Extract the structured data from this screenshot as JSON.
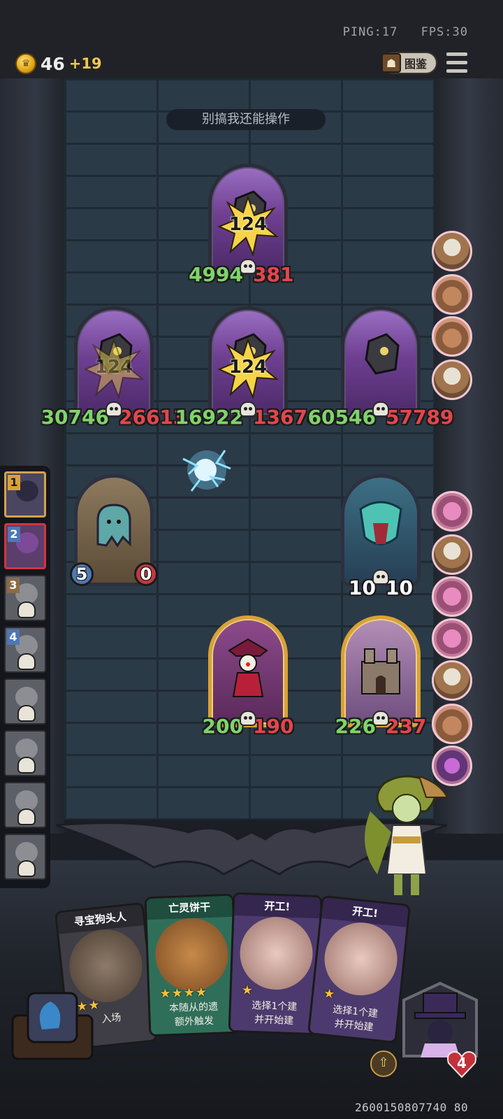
{
  "status": {
    "ping": "PING:17",
    "fps": "FPS:30"
  },
  "currency": {
    "gold": "46",
    "gold_income": "+19"
  },
  "codex": {
    "label": "图鉴"
  },
  "banner": "别搞我还能操作",
  "enemy_board": [
    {
      "name": "enemy-top",
      "damage": "124",
      "attack": "4994",
      "health": "381"
    },
    {
      "name": "enemy-mid-left",
      "damage": "124",
      "attack": "30746",
      "health": "26613"
    },
    {
      "name": "enemy-mid-center",
      "damage": "124",
      "attack": "16922",
      "health": "13674"
    },
    {
      "name": "enemy-mid-right",
      "attack": "60546",
      "health": "57789"
    }
  ],
  "lower_board": [
    {
      "name": "ghost",
      "attack": "5",
      "health": "0"
    },
    {
      "name": "spirit-titan",
      "attack": "10",
      "health": "10"
    }
  ],
  "player_board": [
    {
      "name": "clown",
      "attack": "200",
      "health": "190"
    },
    {
      "name": "castle",
      "attack": "226",
      "health": "237"
    }
  ],
  "roster": [
    {
      "rank": "1",
      "style": "gold"
    },
    {
      "rank": "2",
      "style": "blue"
    },
    {
      "rank": "3",
      "style": "brown"
    },
    {
      "rank": "4",
      "style": "blue"
    },
    {
      "rank": "",
      "style": ""
    },
    {
      "rank": "",
      "style": ""
    },
    {
      "rank": "",
      "style": ""
    },
    {
      "rank": "",
      "style": ""
    }
  ],
  "enemy_roster_icons": [
    "ship-icon",
    "cart-icon",
    "cart-icon",
    "ship-icon",
    "pink-cart-icon",
    "ship-icon",
    "pink-cart-icon",
    "pink-cart-icon",
    "ship-icon",
    "cart-icon",
    "purple-creature-icon"
  ],
  "hand": [
    {
      "title": "寻宝狗头人",
      "stars": "★★",
      "desc_a": "入场",
      "desc_b": "",
      "color": "#3f3d45"
    },
    {
      "title": "亡灵饼干",
      "stars": "★★★★",
      "desc_a": "本随从的遗",
      "desc_b": "额外触发",
      "color": "#2f6f5a"
    },
    {
      "title": "开工!",
      "stars": "★",
      "desc_a": "选择1个建",
      "desc_b": "并开始建",
      "color": "#4c3a6e"
    },
    {
      "title": "开工!",
      "stars": "★",
      "desc_a": "选择1个建",
      "desc_b": "并开始建",
      "color": "#4c3a6e"
    }
  ],
  "player": {
    "health": "4"
  },
  "uid": "2600150807740 80"
}
